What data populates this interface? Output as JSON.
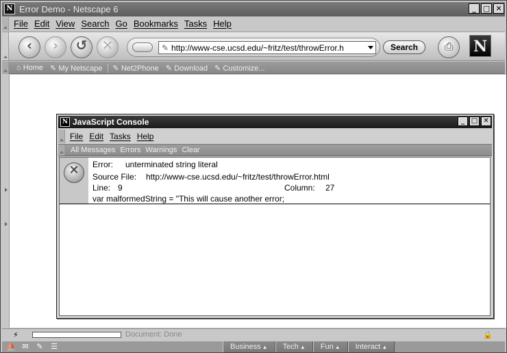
{
  "window": {
    "title": "Error Demo - Netscape 6",
    "app_icon": "N",
    "buttons": {
      "minimize": "_",
      "maximize": "□",
      "close": "✕"
    }
  },
  "menu": [
    "File",
    "Edit",
    "View",
    "Search",
    "Go",
    "Bookmarks",
    "Tasks",
    "Help"
  ],
  "navigation": {
    "url": "http://www-cse.ucsd.edu/~fritz/test/throwError.h",
    "search_label": "Search",
    "logo_letter": "N",
    "icons": [
      "back-icon",
      "forward-icon",
      "reload-icon",
      "stop-icon",
      "print-icon"
    ]
  },
  "personal_toolbar": [
    "Home",
    "My Netscape",
    "Net2Phone",
    "Download",
    "Customize..."
  ],
  "status": {
    "text": "Document: Done"
  },
  "taskbar": {
    "tabs": [
      "Business",
      "Tech",
      "Fun",
      "Interact"
    ]
  },
  "console": {
    "title": "JavaScript Console",
    "app_icon": "N",
    "menu": [
      "File",
      "Edit",
      "Tasks",
      "Help"
    ],
    "toolbar": [
      "All Messages",
      "Errors",
      "Warnings",
      "Clear"
    ],
    "entry": {
      "error_label": "Error:",
      "error_message": "unterminated string literal",
      "source_label": "Source File:",
      "source_file": "http://www-cse.ucsd.edu/~fritz/test/throwError.html",
      "line_label": "Line:",
      "line_value": "9",
      "column_label": "Column:",
      "column_value": "27",
      "code": "var malformedString = \"This will cause another error;"
    }
  }
}
